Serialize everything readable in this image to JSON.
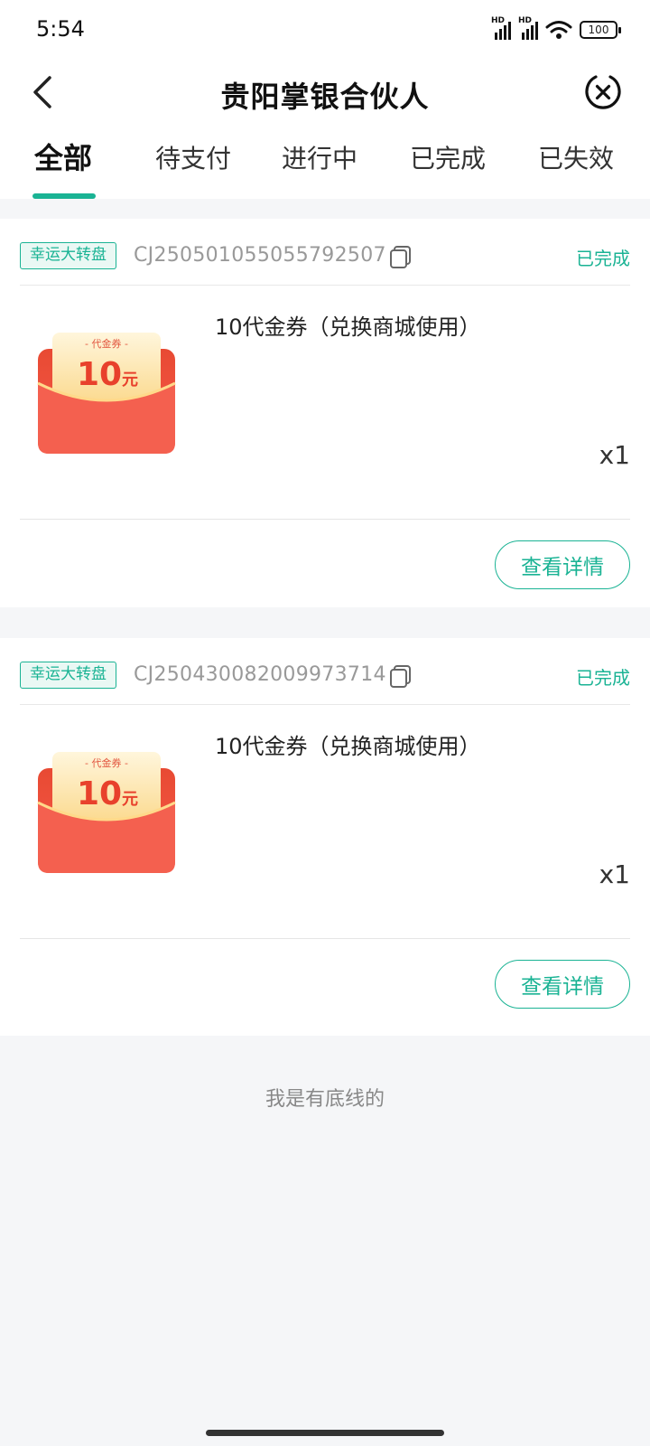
{
  "status_bar": {
    "time": "5:54",
    "signal_1": "HD",
    "signal_2": "HD",
    "battery": "100"
  },
  "header": {
    "title": "贵阳掌银合伙人",
    "back_icon": "back-arrow-icon",
    "close_icon": "close-circle-icon"
  },
  "tabs": [
    {
      "label": "全部",
      "active": true
    },
    {
      "label": "待支付",
      "active": false
    },
    {
      "label": "进行中",
      "active": false
    },
    {
      "label": "已完成",
      "active": false
    },
    {
      "label": "已失效",
      "active": false
    }
  ],
  "orders": [
    {
      "tag": "幸运大转盘",
      "order_no": "CJ250501055055792507",
      "status": "已完成",
      "product_name": "10代金券（兑换商城使用）",
      "voucher_label": "- 代金券 -",
      "voucher_amount": "10",
      "voucher_unit": "元",
      "qty": "x1",
      "detail_button": "查看详情"
    },
    {
      "tag": "幸运大转盘",
      "order_no": "CJ250430082009973714",
      "status": "已完成",
      "product_name": "10代金券（兑换商城使用）",
      "voucher_label": "- 代金券 -",
      "voucher_amount": "10",
      "voucher_unit": "元",
      "qty": "x1",
      "detail_button": "查看详情"
    }
  ],
  "footer": {
    "end_text": "我是有底线的"
  },
  "colors": {
    "accent": "#1ab394",
    "background": "#f5f6f8",
    "voucher_red": "#f04b3a",
    "voucher_gold": "#fde7b0"
  }
}
